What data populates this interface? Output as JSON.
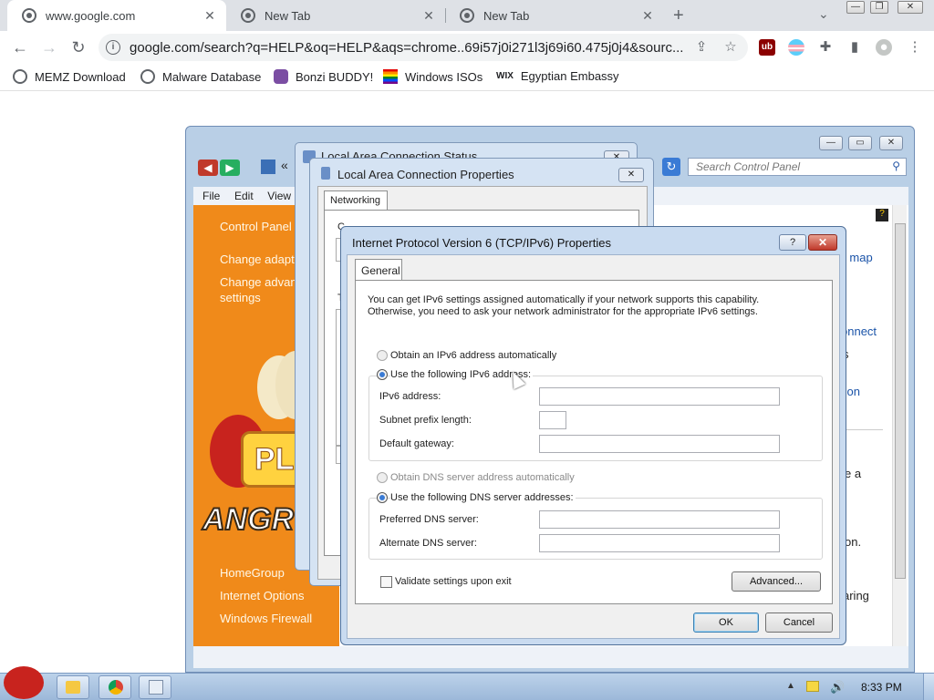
{
  "browser": {
    "tabs": [
      {
        "title": "www.google.com"
      },
      {
        "title": "New Tab"
      },
      {
        "title": "New Tab"
      }
    ],
    "url": "google.com/search?q=HELP&oq=HELP&aqs=chrome..69i57j0i271l3j69i60.475j0j4&sourc...",
    "bookmarks": [
      "MEMZ Download",
      "Malware Database",
      "Bonzi BUDDY!",
      "Windows ISOs",
      "Egyptian Embassy"
    ]
  },
  "control_panel": {
    "search_placeholder": "Search Control Panel",
    "menu": [
      "File",
      "Edit",
      "View"
    ],
    "left_links": [
      "Control Panel",
      "Change adapt",
      "Change advan",
      "settings",
      "HomeGroup",
      "Internet Options",
      "Windows Firewall"
    ],
    "play_text": "PLA",
    "angry_text": "ANGRY",
    "right_fragments": [
      "ll map",
      "onnect",
      "s",
      "tion",
      "e a",
      "on.",
      "aring"
    ]
  },
  "lac_props": {
    "title": "Local Area Connection Properties",
    "tab": "Networking",
    "frag1": "C",
    "frag2": "T"
  },
  "lac_status": {
    "title": "Local Area Connection Status"
  },
  "ipv6_dialog": {
    "title": "Internet Protocol Version 6 (TCP/IPv6) Properties",
    "help": "?",
    "tab": "General",
    "intro_line1": "You can get IPv6 settings assigned automatically if your network supports this capability.",
    "intro_line2": "Otherwise, you need to ask your network administrator for the appropriate IPv6 settings.",
    "opt_auto": "Obtain an IPv6 address automatically",
    "opt_manual": "Use the following IPv6 address:",
    "ipv6_address_label": "IPv6 address:",
    "subnet_label": "Subnet prefix length:",
    "gateway_label": "Default gateway:",
    "dns_auto": "Obtain DNS server address automatically",
    "dns_manual": "Use the following DNS server addresses:",
    "preferred_dns_label": "Preferred DNS server:",
    "alternate_dns_label": "Alternate DNS server:",
    "validate_label": "Validate settings upon exit",
    "advanced_label": "Advanced...",
    "ok_label": "OK",
    "cancel_label": "Cancel",
    "ipv6_address_value": "",
    "subnet_value": "",
    "gateway_value": "",
    "preferred_dns_value": "",
    "alternate_dns_value": "",
    "selected_address_option": "manual",
    "selected_dns_option": "manual",
    "validate_checked": false
  },
  "taskbar": {
    "clock": "8:33 PM"
  }
}
